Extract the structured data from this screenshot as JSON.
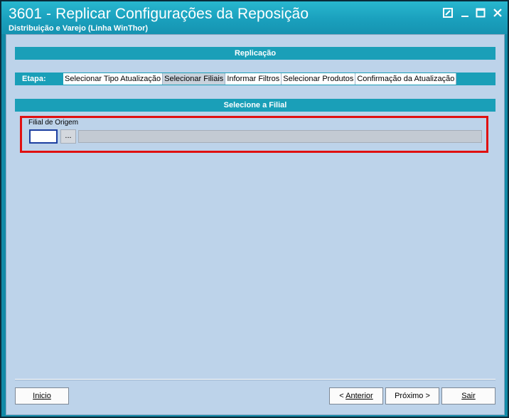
{
  "window": {
    "title": "3601 - Replicar Configurações da Reposição",
    "subtitle": "Distribuição e Varejo (Linha WinThor)"
  },
  "header_bar": {
    "label": "Replicação"
  },
  "etapa": {
    "label": "Etapa:",
    "steps": [
      {
        "label": "Selecionar Tipo Atualização",
        "active": false
      },
      {
        "label": "Selecionar Filiais",
        "active": true
      },
      {
        "label": "Informar Filtros",
        "active": false
      },
      {
        "label": "Selecionar Produtos",
        "active": false
      },
      {
        "label": "Confirmação da Atualização",
        "active": false
      }
    ]
  },
  "section": {
    "title": "Selecione a Filial",
    "filial_origem": {
      "label": "Filial de Origem",
      "code_value": "",
      "lookup_label": "...",
      "description": ""
    }
  },
  "footer": {
    "inicio": "Inicio",
    "anterior_prefix": "< ",
    "anterior": "Anterior",
    "proximo": "Próximo >",
    "sair": "Sair"
  },
  "colors": {
    "accent": "#1a9fb8",
    "background": "#bdd3ea",
    "highlight": "#e01010"
  }
}
